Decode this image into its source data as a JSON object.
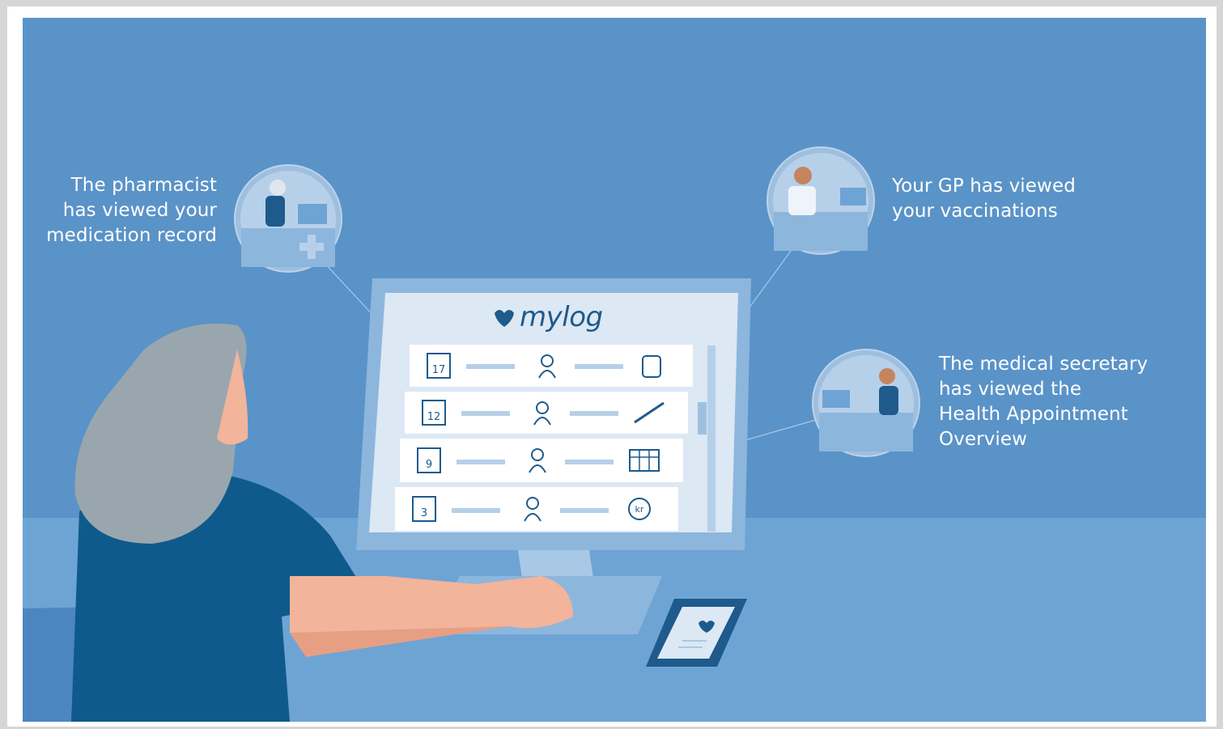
{
  "brand": {
    "name": "mylog",
    "icon": "heart-icon"
  },
  "captions": {
    "pharmacist": "The pharmacist\nhas viewed your\nmedication record",
    "gp": "Your GP has viewed\nyour vaccinations",
    "secretary": "The medical secretary\nhas viewed the\nHealth Appointment\nOverview"
  },
  "log_rows": [
    {
      "date": "17",
      "person_icon": "doctor-icon",
      "item_icon": "medicine-jar-icon"
    },
    {
      "date": "12",
      "person_icon": "nurse-icon",
      "item_icon": "syringe-icon"
    },
    {
      "date": "9",
      "person_icon": "doctor-stethoscope-icon",
      "item_icon": "calendar-grid-icon"
    },
    {
      "date": "3",
      "person_icon": "secretary-icon",
      "item_icon": "payment-kr-icon"
    }
  ],
  "colors": {
    "wall": "#5a93c8",
    "floor": "#6ea4d4",
    "screen_bg": "#dce8f4",
    "dark_blue": "#0f5a8c",
    "skin": "#f2b49a",
    "hair": "#9aa6ad"
  }
}
